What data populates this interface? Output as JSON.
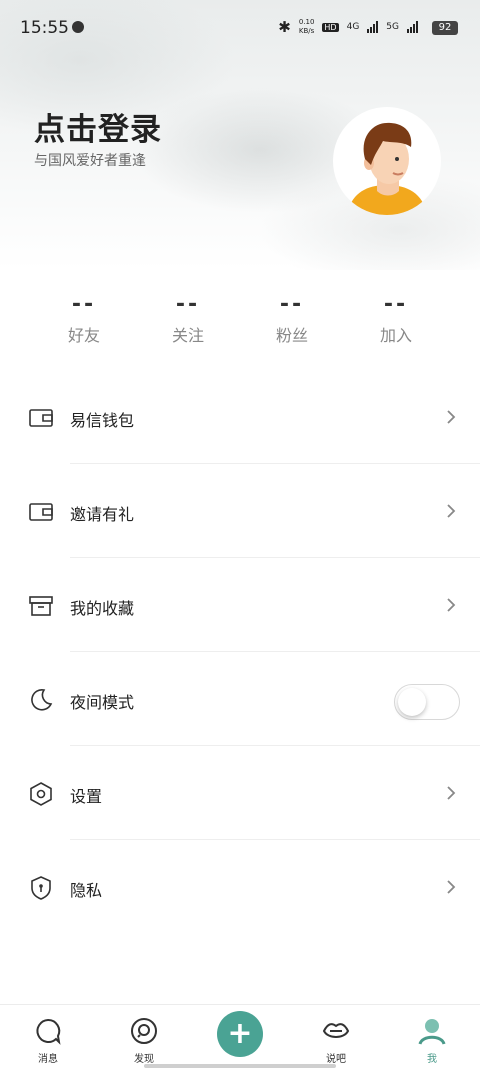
{
  "status_bar": {
    "time": "15:55",
    "speed_value": "0.10",
    "speed_unit": "KB/s",
    "hd": "HD",
    "net1": "4G",
    "net2": "5G",
    "battery": "92"
  },
  "profile": {
    "title": "点击登录",
    "subtitle": "与国风爱好者重逢"
  },
  "stats": [
    {
      "value": "--",
      "label": "好友"
    },
    {
      "value": "--",
      "label": "关注"
    },
    {
      "value": "--",
      "label": "粉丝"
    },
    {
      "value": "--",
      "label": "加入"
    }
  ],
  "menu": [
    {
      "label": "易信钱包",
      "icon": "wallet-icon"
    },
    {
      "label": "邀请有礼",
      "icon": "wallet-icon"
    },
    {
      "label": "我的收藏",
      "icon": "archive-icon"
    },
    {
      "label": "夜间模式",
      "icon": "moon-icon",
      "toggle_on": false
    },
    {
      "label": "设置",
      "icon": "hexagon-settings-icon"
    },
    {
      "label": "隐私",
      "icon": "shield-icon"
    }
  ],
  "tabs": [
    {
      "label": "消息",
      "icon": "message-icon"
    },
    {
      "label": "发现",
      "icon": "discover-icon"
    },
    {
      "label": "",
      "icon": "plus-icon"
    },
    {
      "label": "说吧",
      "icon": "lips-icon"
    },
    {
      "label": "我",
      "icon": "person-icon",
      "active": true
    }
  ],
  "colors": {
    "accent": "#4aa394",
    "active_tab": "#4a9a8a"
  }
}
